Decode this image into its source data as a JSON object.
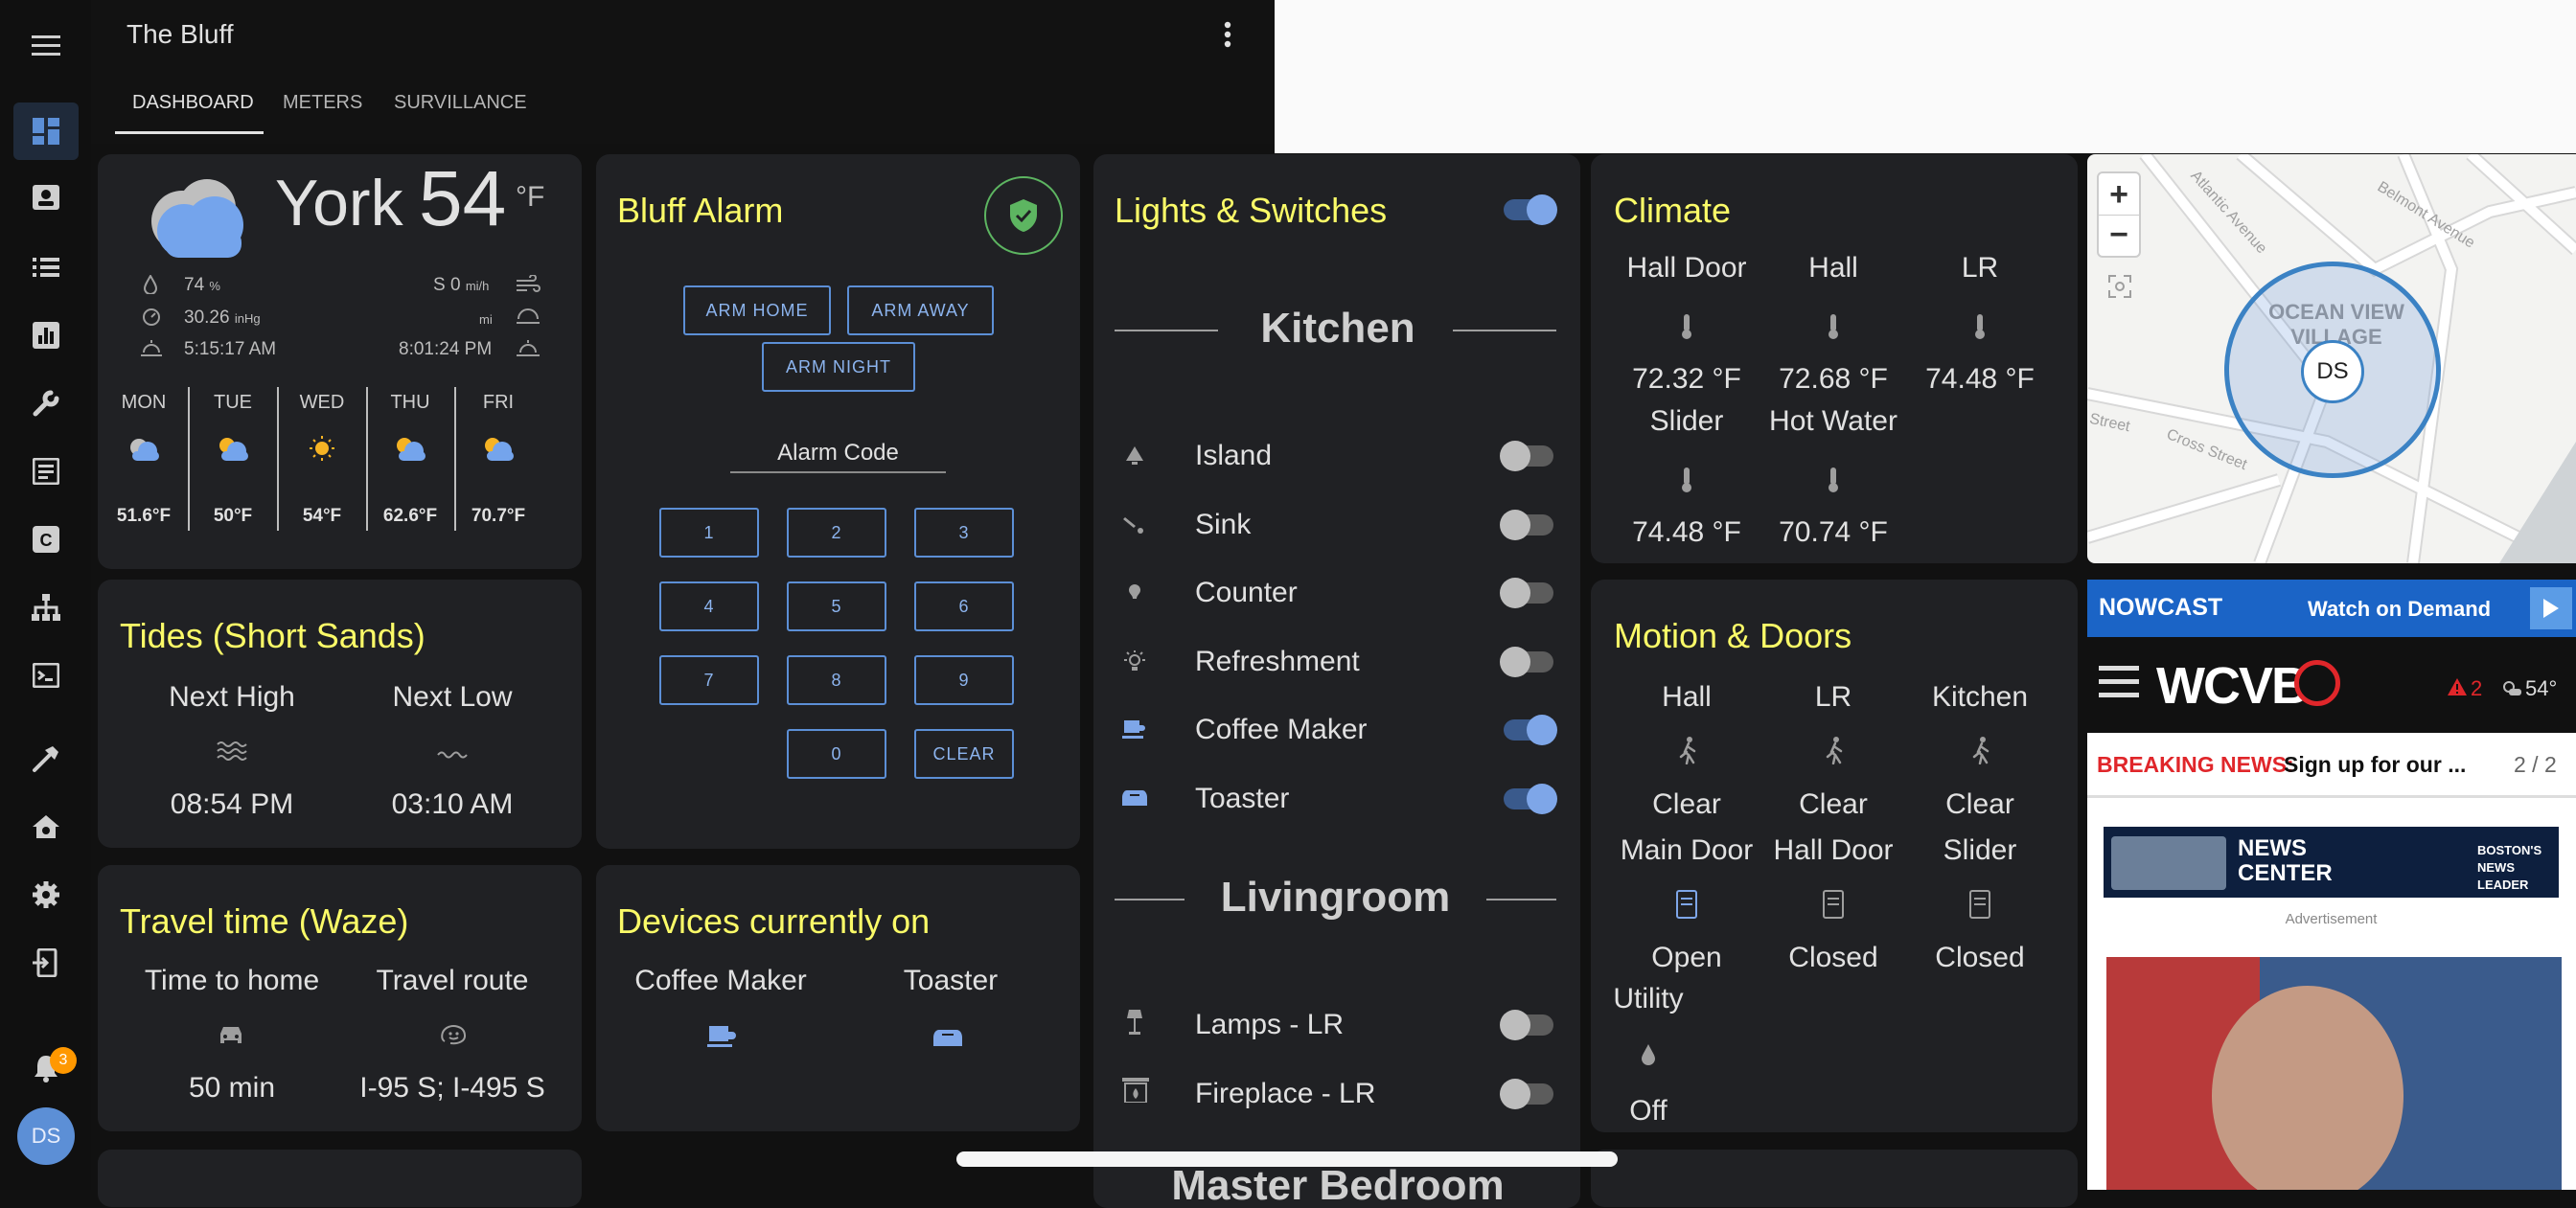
{
  "app": {
    "title": "The Bluff",
    "tabs": [
      "DASHBOARD",
      "METERS",
      "SURVILLANCE"
    ]
  },
  "sidebar": {
    "notification_count": "3",
    "avatar": "DS"
  },
  "weather": {
    "city": "York",
    "temp": "54",
    "unit": "°F",
    "humidity": "74",
    "humidity_unit": "%",
    "pressure": "30.26",
    "pressure_unit": "inHg",
    "sunrise": "5:15:17 AM",
    "sunset": "8:01:24 PM",
    "wind": "S 0",
    "wind_unit": "mi/h",
    "visibility_unit": "mi",
    "forecast": [
      {
        "day": "MON",
        "temp": "51.6°F",
        "icon": "cloudy-icon"
      },
      {
        "day": "TUE",
        "temp": "50°F",
        "icon": "partly-cloudy-icon"
      },
      {
        "day": "WED",
        "temp": "54°F",
        "icon": "sunny-icon"
      },
      {
        "day": "THU",
        "temp": "62.6°F",
        "icon": "partly-cloudy-icon"
      },
      {
        "day": "FRI",
        "temp": "70.7°F",
        "icon": "partly-cloudy-icon"
      }
    ]
  },
  "tides": {
    "title": "Tides (Short Sands)",
    "high_label": "Next High",
    "low_label": "Next Low",
    "high": "08:54 PM",
    "low": "03:10 AM"
  },
  "travel": {
    "title": "Travel time (Waze)",
    "home_label": "Time to home",
    "route_label": "Travel route",
    "home": "50 min",
    "route": "I-95 S; I-495 S"
  },
  "alarm": {
    "title": "Bluff Alarm",
    "arm_home": "ARM HOME",
    "arm_away": "ARM AWAY",
    "arm_night": "ARM NIGHT",
    "code_label": "Alarm Code",
    "keys": [
      "1",
      "2",
      "3",
      "4",
      "5",
      "6",
      "7",
      "8",
      "9",
      "0",
      "CLEAR"
    ]
  },
  "devices": {
    "title": "Devices currently on",
    "items": [
      "Coffee Maker",
      "Toaster"
    ]
  },
  "lights": {
    "title": "Lights & Switches",
    "kitchen_header": "Kitchen",
    "kitchen": [
      {
        "name": "Island",
        "on": false
      },
      {
        "name": "Sink",
        "on": false
      },
      {
        "name": "Counter",
        "on": false
      },
      {
        "name": "Refreshment",
        "on": false
      },
      {
        "name": "Coffee Maker",
        "on": true
      },
      {
        "name": "Toaster",
        "on": true
      }
    ],
    "living_header": "Livingroom",
    "living": [
      {
        "name": "Lamps - LR",
        "on": false
      },
      {
        "name": "Fireplace - LR",
        "on": false
      }
    ],
    "master_header": "Master Bedroom"
  },
  "climate": {
    "title": "Climate",
    "sensors": [
      {
        "name": "Hall Door",
        "value": "72.32 °F"
      },
      {
        "name": "Hall",
        "value": "72.68 °F"
      },
      {
        "name": "LR",
        "value": "74.48 °F"
      },
      {
        "name": "Slider",
        "value": "74.48 °F"
      },
      {
        "name": "Hot Water",
        "value": "70.74 °F"
      }
    ]
  },
  "motion": {
    "title": "Motion & Doors",
    "motion": [
      {
        "name": "Hall",
        "state": "Clear"
      },
      {
        "name": "LR",
        "state": "Clear"
      },
      {
        "name": "Kitchen",
        "state": "Clear"
      }
    ],
    "doors": [
      {
        "name": "Main Door",
        "state": "Open"
      },
      {
        "name": "Hall Door",
        "state": "Closed"
      },
      {
        "name": "Slider",
        "state": "Closed"
      }
    ],
    "utility": {
      "name": "Utility",
      "state": "Off"
    }
  },
  "map": {
    "zoom_in": "+",
    "zoom_out": "−",
    "streets": [
      "Atlantic Avenue",
      "Belmont Avenue",
      "Street",
      "Cross Street"
    ],
    "area": "OCEAN VIEW\nVILLAGE",
    "marker": "DS"
  },
  "news": {
    "nowcast": "NOWCAST",
    "watch": "Watch on Demand",
    "logo": "WCVB",
    "alerts": "2",
    "temp": "54°",
    "breaking_label": "BREAKING NEWS:",
    "breaking_text": "Sign up for our ...",
    "page": "2 / 2",
    "ad_text": "NEWS CENTER",
    "ad_tag": "BOSTON'S NEWS LEADER",
    "ad_label": "Advertisement"
  },
  "colors": {
    "accent": "#fbfb68",
    "primary": "#5c8fd6",
    "card": "#202124",
    "bg": "#111111"
  }
}
